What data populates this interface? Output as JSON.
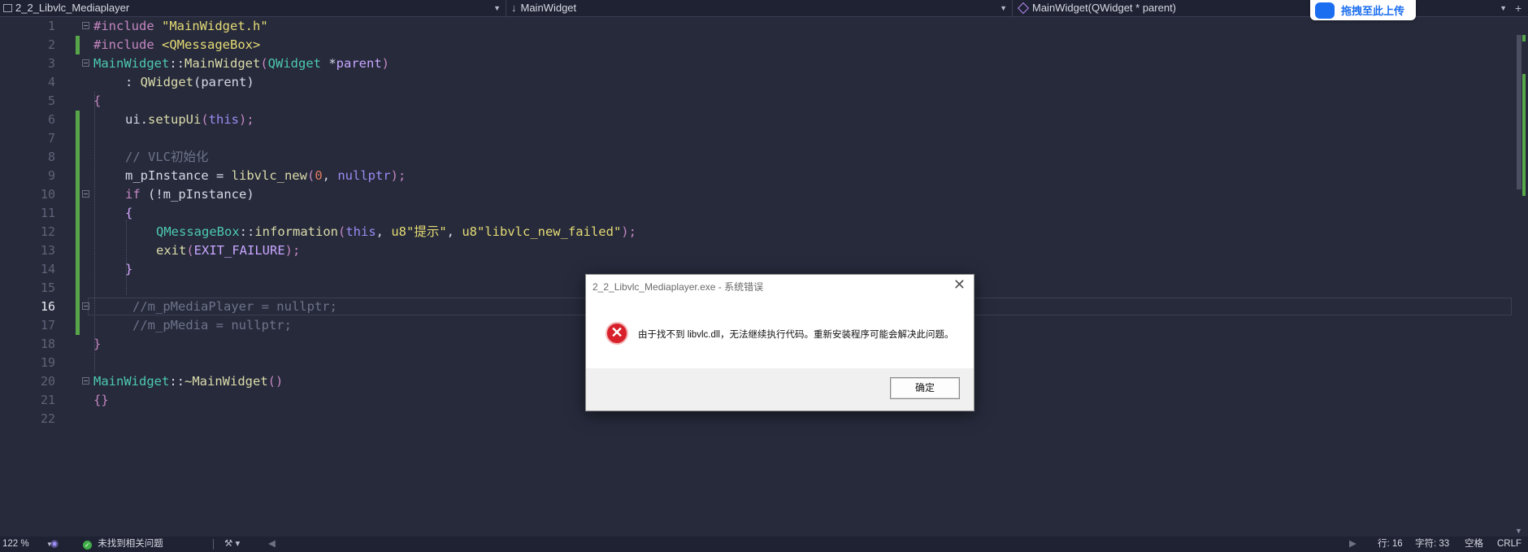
{
  "navbar": {
    "project": "2_2_Libvlc_Mediaplayer",
    "scope": "MainWidget",
    "member": "MainWidget(QWidget * parent)",
    "upload_badge": "拖拽至此上传"
  },
  "editor": {
    "current_line": 16,
    "lines": [
      {
        "n": "1"
      },
      {
        "n": "2"
      },
      {
        "n": "3"
      },
      {
        "n": "4"
      },
      {
        "n": "5"
      },
      {
        "n": "6"
      },
      {
        "n": "7"
      },
      {
        "n": "8"
      },
      {
        "n": "9"
      },
      {
        "n": "10"
      },
      {
        "n": "11"
      },
      {
        "n": "12"
      },
      {
        "n": "13"
      },
      {
        "n": "14"
      },
      {
        "n": "15"
      },
      {
        "n": "16"
      },
      {
        "n": "17"
      },
      {
        "n": "18"
      },
      {
        "n": "19"
      },
      {
        "n": "20"
      },
      {
        "n": "21"
      },
      {
        "n": "22"
      }
    ],
    "code": {
      "l1_kw": "#include",
      "l1_str": "\"MainWidget.h\"",
      "l2_kw": "#include",
      "l2_str": "<QMessageBox>",
      "l3_cls": "MainWidget",
      "l3_op": "::",
      "l3_fn": "MainWidget",
      "l3_p1": "(",
      "l3_type": "QWidget",
      "l3_ptr": " *",
      "l3_param": "parent",
      "l3_p2": ")",
      "l4_colon": ": ",
      "l4_fn": "QWidget",
      "l4_rest": "(parent)",
      "l5": "{",
      "l6_obj": "ui.",
      "l6_fn": "setupUi",
      "l6_p1": "(",
      "l6_kw": "this",
      "l6_p2": ");",
      "l8": "// VLC初始化",
      "l9_lhs": "m_pInstance = ",
      "l9_fn": "libvlc_new",
      "l9_p1": "(",
      "l9_num": "0",
      "l9_comma": ", ",
      "l9_kw": "nullptr",
      "l9_p2": ");",
      "l10_kw": "if",
      "l10_rest": " (!m_pInstance)",
      "l11": "{",
      "l12_cls": "QMessageBox",
      "l12_op": "::",
      "l12_fn": "information",
      "l12_p1": "(",
      "l12_kw": "this",
      "l12_c1": ", ",
      "l12_s1": "u8\"提示\"",
      "l12_c2": ", ",
      "l12_s2": "u8\"libvlc_new_failed\"",
      "l12_p2": ");",
      "l13_fn": "exit",
      "l13_p1": "(",
      "l13_mac": "EXIT_FAILURE",
      "l13_p2": ");",
      "l14": "}",
      "l16": "//m_pMediaPlayer = nullptr;",
      "l17": "//m_pMedia = nullptr;",
      "l18": "}",
      "l20_cls": "MainWidget",
      "l20_op": "::",
      "l20_fn": "~MainWidget",
      "l20_p": "()",
      "l21": "{}"
    }
  },
  "dialog": {
    "title": "2_2_Libvlc_Mediaplayer.exe - 系统错误",
    "message": "由于找不到 libvlc.dll，无法继续执行代码。重新安装程序可能会解决此问题。",
    "ok_label": "确定",
    "close_glyph": "✕",
    "icon_glyph": "✕"
  },
  "statusbar": {
    "zoom": "122 %",
    "issues": "未找到相关问题",
    "line": "行: 16",
    "char": "字符: 33",
    "whitespace": "空格",
    "eol": "CRLF"
  },
  "colors": {
    "editor_bg": "#262a3b",
    "modified_bar": "#57a64a",
    "error_icon": "#d8212a",
    "accent": "#1b6ef0"
  }
}
